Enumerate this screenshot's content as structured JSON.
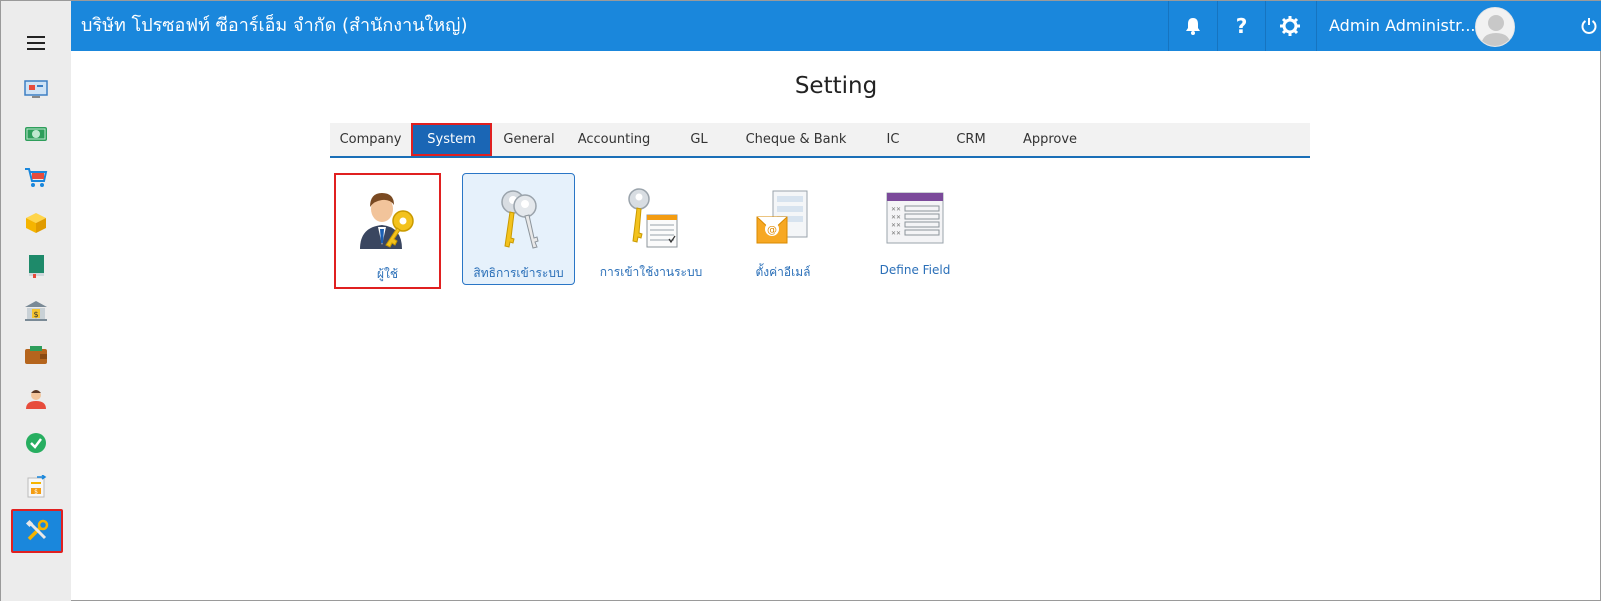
{
  "header": {
    "company": "บริษัท โปรซอฟท์ ซีอาร์เอ็ม จำกัด (สำนักงานใหญ่)",
    "user_name": "Admin Administr...",
    "icons": [
      "bell-icon",
      "help-icon",
      "gear-icon",
      "avatar",
      "power-icon"
    ]
  },
  "sidebar": {
    "items": [
      "menu-icon",
      "dashboard-icon",
      "money-icon",
      "cart-icon",
      "box-icon",
      "book-icon",
      "bank-icon",
      "wallet-icon",
      "contact-icon",
      "approve-icon",
      "transfer-icon",
      "settings-tools-icon"
    ],
    "active": "settings-tools-icon"
  },
  "page": {
    "title": "Setting"
  },
  "tabs": [
    {
      "label": "Company"
    },
    {
      "label": "System",
      "active": true
    },
    {
      "label": "General"
    },
    {
      "label": "Accounting"
    },
    {
      "label": "GL"
    },
    {
      "label": "Cheque & Bank"
    },
    {
      "label": "IC"
    },
    {
      "label": "CRM"
    },
    {
      "label": "Approve"
    }
  ],
  "tiles": [
    {
      "label": "ผู้ใช้",
      "icon": "user-key-icon"
    },
    {
      "label": "สิทธิการเข้าระบบ",
      "icon": "keys-icon"
    },
    {
      "label": "การเข้าใช้งานระบบ",
      "icon": "key-log-icon"
    },
    {
      "label": "ตั้งค่าอีเมล์",
      "icon": "email-settings-icon"
    },
    {
      "label": "Define Field",
      "icon": "define-field-icon"
    }
  ],
  "colors": {
    "accent": "#1a87dc",
    "active_tab": "#1a66b5",
    "highlight_border": "#e02020",
    "link": "#2a6fb8"
  }
}
